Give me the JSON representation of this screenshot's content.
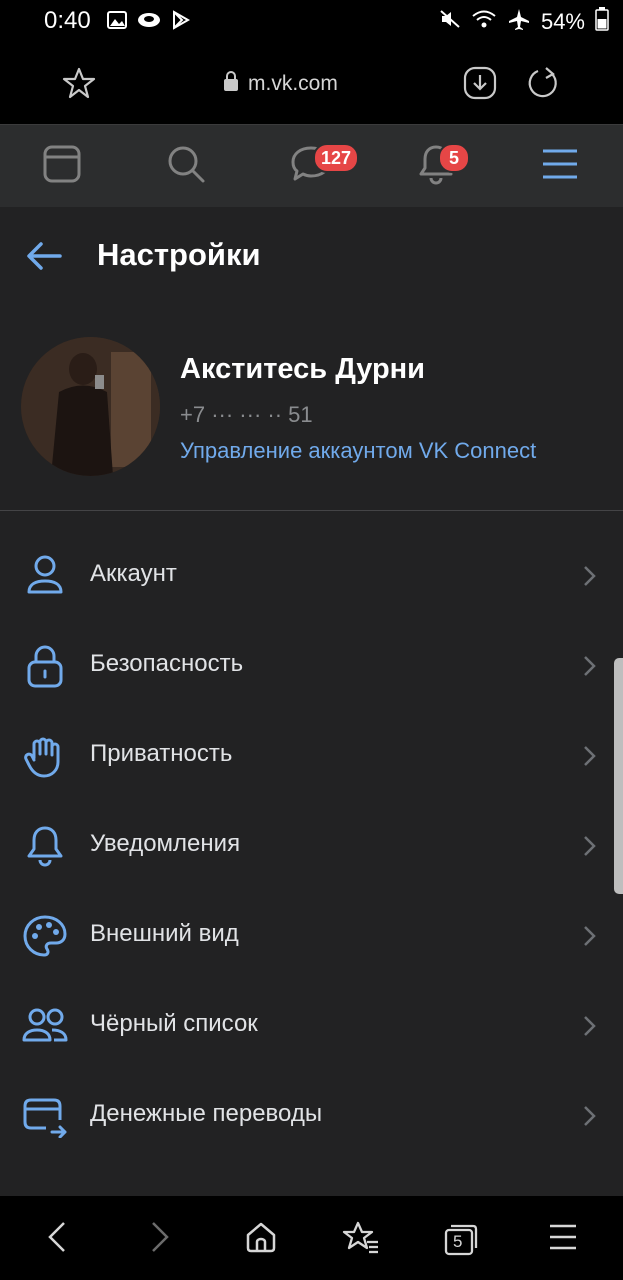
{
  "status": {
    "time": "0:40",
    "battery": "54%",
    "icons": [
      "gallery-icon",
      "cloud-icon",
      "play-store-icon",
      "mute-icon",
      "wifi-icon",
      "airplane-icon",
      "battery-icon"
    ]
  },
  "browser": {
    "url": "m.vk.com",
    "icons": [
      "star-icon",
      "lock-icon",
      "download-icon",
      "reload-icon"
    ]
  },
  "nav": {
    "messages_badge": "127",
    "notifications_badge": "5",
    "icons": [
      "feed-icon",
      "search-icon",
      "messages-icon",
      "notifications-icon",
      "menu-icon"
    ]
  },
  "header": {
    "title": "Настройки"
  },
  "profile": {
    "name": "Акститесь Дурни",
    "phone": "+7 ··· ··· ·· 51",
    "link": "Управление аккаунтом VK Connect"
  },
  "menu": {
    "items": [
      {
        "label": "Аккаунт",
        "icon": "user-icon"
      },
      {
        "label": "Безопасность",
        "icon": "lock-icon"
      },
      {
        "label": "Приватность",
        "icon": "hand-icon"
      },
      {
        "label": "Уведомления",
        "icon": "bell-icon"
      },
      {
        "label": "Внешний вид",
        "icon": "palette-icon"
      },
      {
        "label": "Чёрный список",
        "icon": "users-icon"
      },
      {
        "label": "Денежные переводы",
        "icon": "card-icon"
      }
    ]
  },
  "bottom": {
    "tabs_count": "5",
    "icons": [
      "back-icon",
      "forward-icon",
      "home-icon",
      "bookmarks-icon",
      "tabs-icon",
      "more-menu-icon"
    ]
  },
  "colors": {
    "accent": "#71aaeb",
    "badge": "#e64646",
    "background": "#222223",
    "nav_bg": "#2c2d2e"
  }
}
